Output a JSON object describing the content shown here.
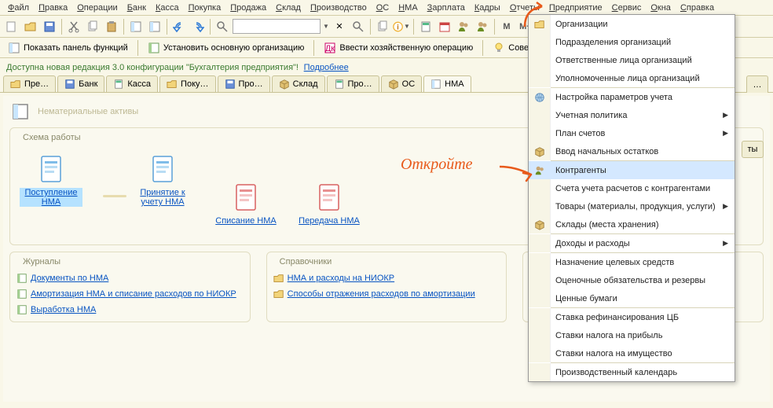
{
  "menu": [
    "Файл",
    "Правка",
    "Операции",
    "Банк",
    "Касса",
    "Покупка",
    "Продажа",
    "Склад",
    "Производство",
    "ОС",
    "НМА",
    "Зарплата",
    "Кадры",
    "Отчеты",
    "Предприятие",
    "Сервис",
    "Окна",
    "Справка"
  ],
  "toolbar2": {
    "panel": "Показать панель функций",
    "main_org": "Установить основную организацию",
    "operation": "Ввести хозяйственную операцию",
    "tips": "Советы"
  },
  "search": {
    "placeholder": ""
  },
  "infobar": {
    "text": "Доступна новая редакция 3.0 конфигурации \"Бухгалтерия предприятия\"!",
    "link": "Подробнее"
  },
  "tabs": [
    "Пре…",
    "Банк",
    "Касса",
    "Поку…",
    "Про…",
    "Склад",
    "Про…",
    "ОС",
    "НМА"
  ],
  "page": {
    "title": "Нематериальные активы",
    "schema_title": "Схема работы",
    "nodes": {
      "p": "Поступление НМА",
      "a": "Принятие к учету НМА",
      "w": "Списание НМА",
      "t": "Передача НМА"
    },
    "journals_title": "Журналы",
    "journals": [
      "Документы по НМА",
      "Амортизация НМА и списание расходов по НИОКР",
      "Выработка НМА"
    ],
    "refs_title": "Справочники",
    "refs": [
      "НМА и расходы на НИОКР",
      "Способы отражения расходов по амортизации"
    ]
  },
  "annotation": "Откройте",
  "dropdown": [
    {
      "label": "Организации",
      "icon": "org",
      "sep": false
    },
    {
      "label": "Подразделения организаций",
      "icon": "",
      "sep": false
    },
    {
      "label": "Ответственные лица организаций",
      "icon": "",
      "sep": false
    },
    {
      "label": "Уполномоченные лица организаций",
      "icon": "",
      "sep": true
    },
    {
      "label": "Настройка параметров учета",
      "icon": "globe",
      "sep": false
    },
    {
      "label": "Учетная политика",
      "icon": "",
      "sep": false,
      "sub": true
    },
    {
      "label": "План счетов",
      "icon": "",
      "sep": false,
      "sub": true
    },
    {
      "label": "Ввод начальных остатков",
      "icon": "inbox",
      "sep": true
    },
    {
      "label": "Контрагенты",
      "icon": "people",
      "sep": false,
      "hl": true
    },
    {
      "label": "Счета учета расчетов с контрагентами",
      "icon": "",
      "sep": false
    },
    {
      "label": "Товары (материалы, продукция, услуги)",
      "icon": "",
      "sep": false,
      "sub": true
    },
    {
      "label": "Склады (места хранения)",
      "icon": "store",
      "sep": true
    },
    {
      "label": "Доходы и расходы",
      "icon": "",
      "sep": true,
      "sub": true
    },
    {
      "label": "Назначение целевых средств",
      "icon": "",
      "sep": false
    },
    {
      "label": "Оценочные обязательства и резервы",
      "icon": "",
      "sep": false
    },
    {
      "label": "Ценные бумаги",
      "icon": "",
      "sep": true
    },
    {
      "label": "Ставка рефинансирования ЦБ",
      "icon": "",
      "sep": false
    },
    {
      "label": "Ставки налога на прибыль",
      "icon": "",
      "sep": false
    },
    {
      "label": "Ставки налога на имущество",
      "icon": "",
      "sep": true
    },
    {
      "label": "Производственный календарь",
      "icon": "",
      "sep": false
    }
  ]
}
